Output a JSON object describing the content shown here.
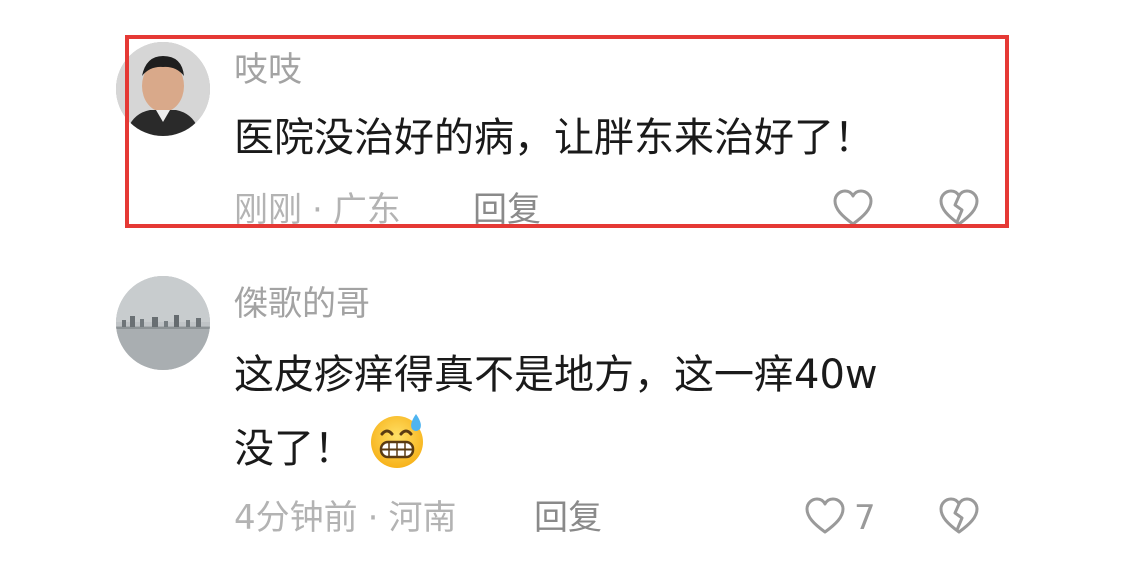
{
  "comments": [
    {
      "username": "吱吱",
      "text": "医院没治好的病，让胖东来治好了！",
      "time": "刚刚",
      "separator": "·",
      "location": "广东",
      "reply_label": "回复",
      "like_icon": "heart-outline-icon",
      "dislike_icon": "broken-heart-icon"
    },
    {
      "username": "傑歌的哥",
      "text_line1": "这皮疹痒得真不是地方，这一痒40w",
      "text_line2": "没了！",
      "emoji": "grinning-sweat-emoji",
      "time": "4分钟前",
      "separator": "·",
      "location": "河南",
      "reply_label": "回复",
      "like_count": "7",
      "like_icon": "heart-outline-icon",
      "dislike_icon": "broken-heart-icon"
    }
  ],
  "colors": {
    "highlight": "#e53935",
    "username": "#a3a3a3",
    "text": "#1a1a1a",
    "meta": "#b3b3b3"
  }
}
